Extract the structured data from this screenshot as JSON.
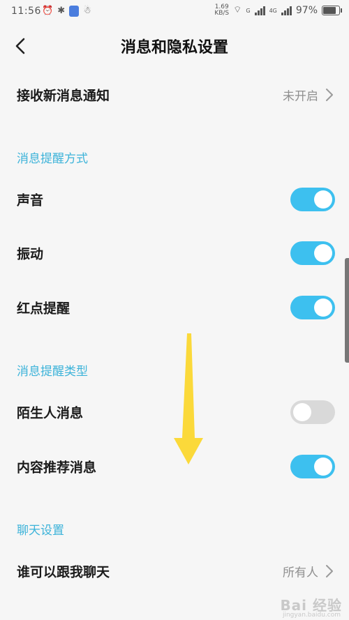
{
  "status_bar": {
    "time": "11:56",
    "speed_value": "1.69",
    "speed_unit": "KB/S",
    "battery": "97%",
    "signal_1_label": "G",
    "signal_2_label": "4G"
  },
  "nav": {
    "title": "消息和隐私设置"
  },
  "rows": {
    "receive_notifications": {
      "label": "接收新消息通知",
      "value": "未开启"
    },
    "sound": {
      "label": "声音",
      "on": true
    },
    "vibration": {
      "label": "振动",
      "on": true
    },
    "red_dot": {
      "label": "红点提醒",
      "on": true
    },
    "stranger_messages": {
      "label": "陌生人消息",
      "on": false
    },
    "recommended_messages": {
      "label": "内容推荐消息",
      "on": true
    },
    "who_can_chat": {
      "label": "谁可以跟我聊天",
      "value": "所有人"
    }
  },
  "sections": {
    "reminder_method": "消息提醒方式",
    "reminder_type": "消息提醒类型",
    "chat_settings": "聊天设置"
  },
  "watermark": {
    "text": "Bai 经验",
    "sub": "jingyan.baidu.com"
  },
  "colors": {
    "accent": "#3dc0ef",
    "section_header": "#3cb3d9",
    "toggle_off": "#d9d9d9",
    "arrow": "#fbd93a"
  }
}
